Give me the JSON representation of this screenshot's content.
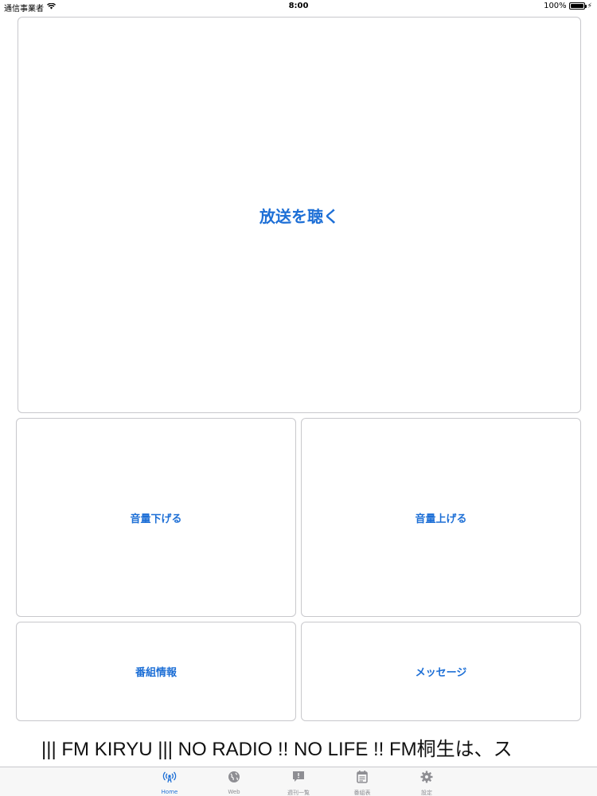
{
  "status_bar": {
    "carrier": "通信事業者",
    "time": "8:00",
    "battery": "100%",
    "battery_level": 1.0
  },
  "main": {
    "listen_label": "放送を聴く",
    "volume_down_label": "音量下げる",
    "volume_up_label": "音量上げる",
    "program_info_label": "番組情報",
    "message_label": "メッセージ"
  },
  "ticker": {
    "text": "||| FM KIRYU ||| NO RADIO !! NO LIFE !!    FM桐生は、ス"
  },
  "tab_bar": {
    "active_color": "#1d6fd6",
    "inactive_color": "#8e8e93",
    "items": [
      {
        "label": "Home",
        "icon": "antenna-icon"
      },
      {
        "label": "Web",
        "icon": "globe-icon"
      },
      {
        "label": "週刊一覧",
        "icon": "message-icon"
      },
      {
        "label": "番組表",
        "icon": "calendar-icon"
      },
      {
        "label": "設定",
        "icon": "gear-icon"
      }
    ]
  }
}
